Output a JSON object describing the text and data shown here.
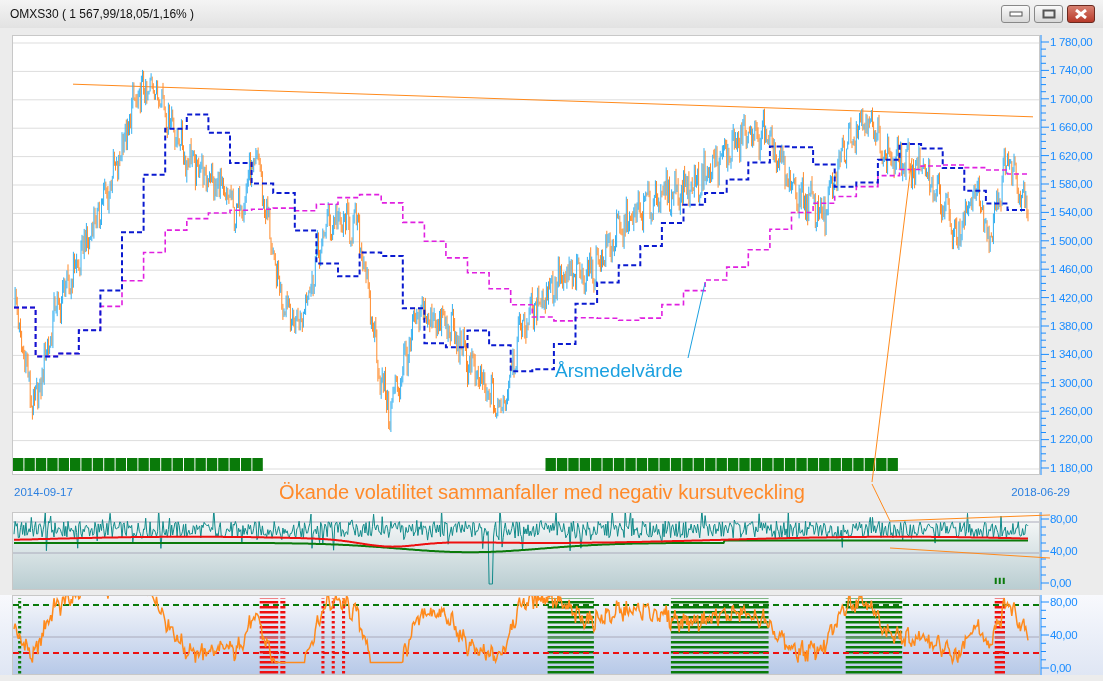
{
  "window": {
    "title": "OMXS30 ( 1 567,99/18,05/1,16% )"
  },
  "price_panel": {
    "y_axis_labels": [
      "1 780,00",
      "1 740,00",
      "1 700,00",
      "1 660,00",
      "1 620,00",
      "1 580,00",
      "1 540,00",
      "1 500,00",
      "1 460,00",
      "1 420,00",
      "1 380,00",
      "1 340,00",
      "1 300,00",
      "1 260,00",
      "1 220,00",
      "1 180,00"
    ],
    "annotation": "Årsmedelvärde"
  },
  "date_range": {
    "start": "2014-09-17",
    "end": "2018-06-29"
  },
  "annotation": "Ökande volatilitet sammanfaller med negativ kursutveckling",
  "volatility_panel": {
    "y_axis_labels": [
      "80,00",
      "40,00",
      "0,00"
    ]
  },
  "oscillator_panel": {
    "y_axis_labels": [
      "80,00",
      "40,00",
      "0,00"
    ]
  }
}
